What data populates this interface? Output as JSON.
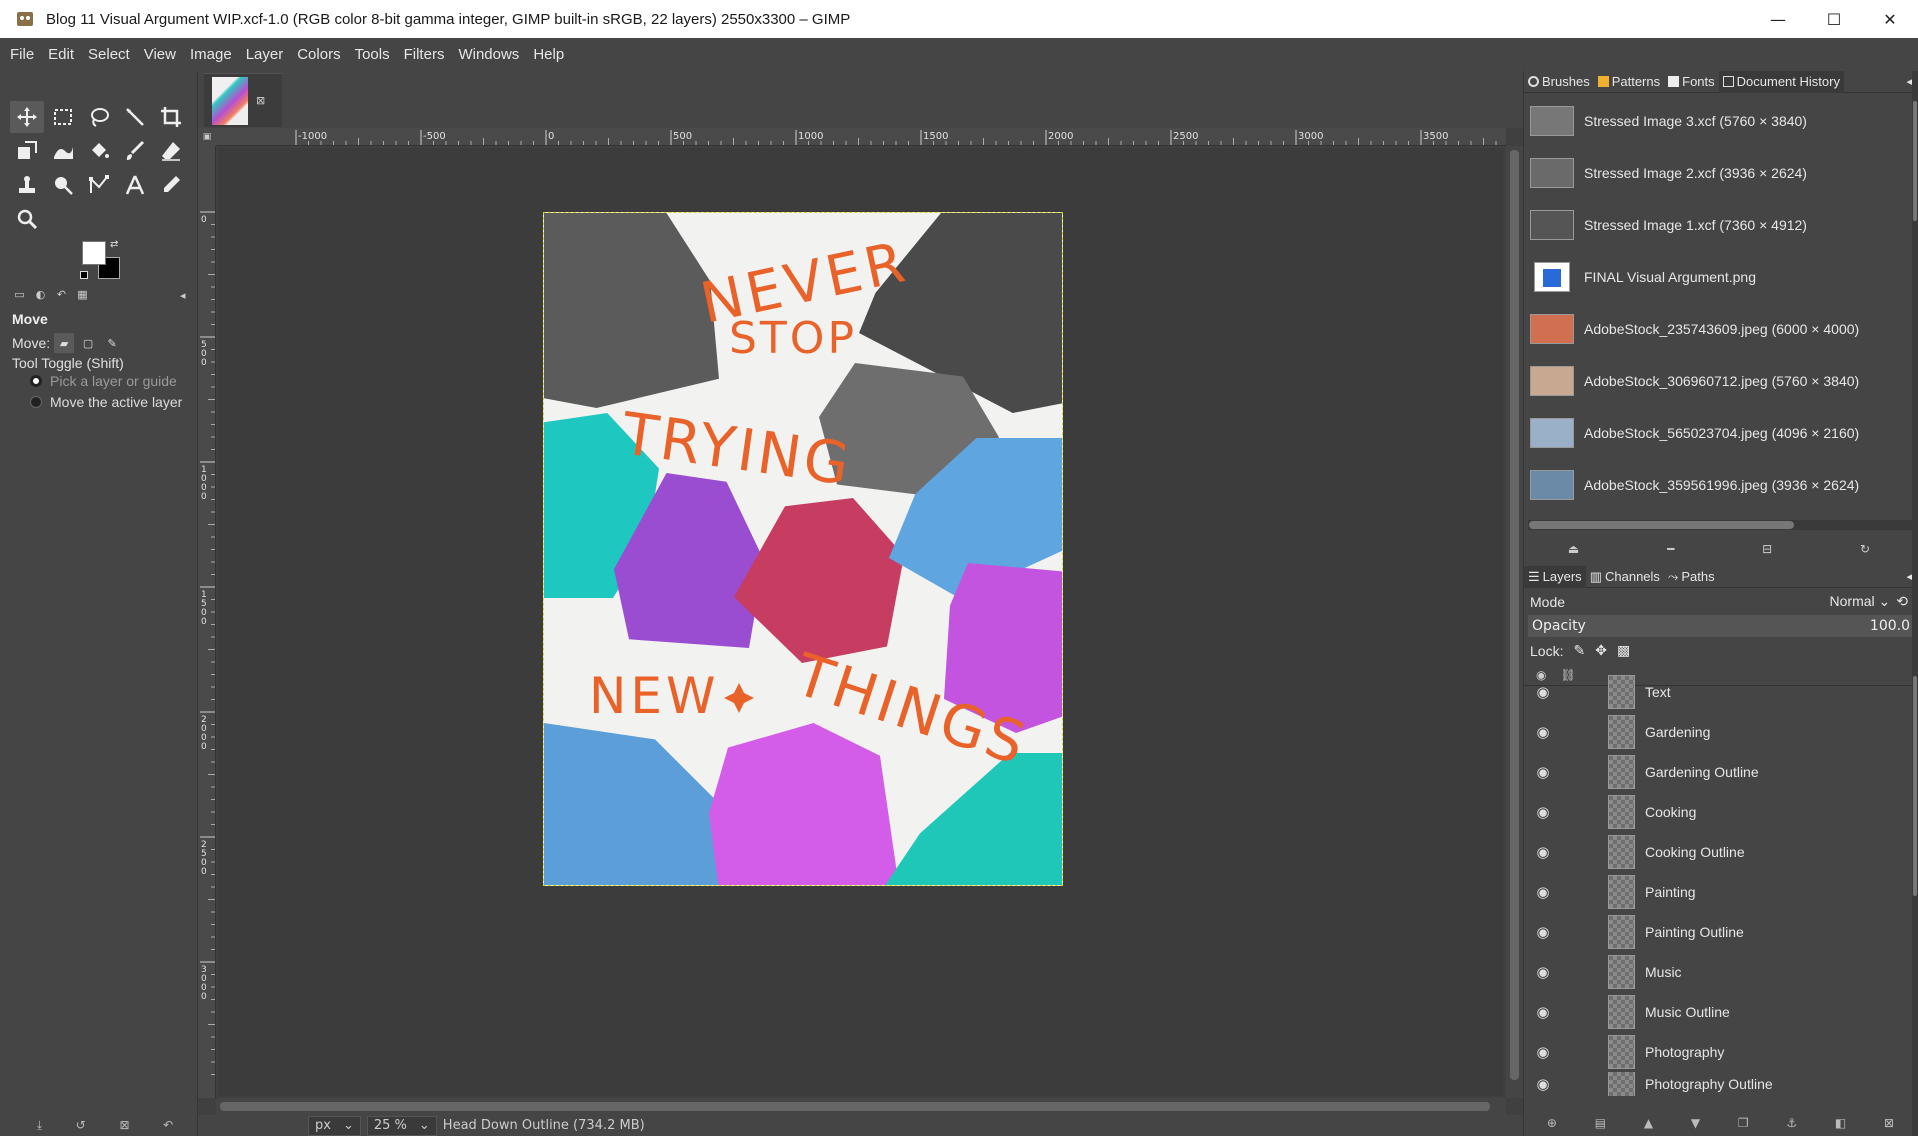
{
  "window": {
    "title": "Blog 11 Visual Argument WIP.xcf-1.0 (RGB color 8-bit gamma integer, GIMP built-in sRGB, 22 layers) 2550x3300 – GIMP",
    "minimize": "—",
    "maximize": "☐",
    "close": "✕"
  },
  "menu": [
    "File",
    "Edit",
    "Select",
    "View",
    "Image",
    "Layer",
    "Colors",
    "Tools",
    "Filters",
    "Windows",
    "Help"
  ],
  "tool_options": {
    "title": "Move",
    "move_label": "Move:",
    "tool_toggle": "Tool Toggle  (Shift)",
    "option1": "Pick a layer or guide",
    "option2": "Move the active layer"
  },
  "ruler": {
    "h_ticks": [
      "-1000",
      "-500",
      "0",
      "500",
      "1000",
      "1500",
      "2000",
      "2500",
      "3000",
      "3500"
    ],
    "v_ticks": [
      "0",
      "500",
      "1000",
      "1500",
      "2000",
      "2500",
      "3000"
    ]
  },
  "poster": {
    "line1": "NEVER",
    "line2": "STOP",
    "line3": "TRYING",
    "line4": "NEW",
    "line5": "THINGS",
    "accent": "#e8622a"
  },
  "status": {
    "unit": "px",
    "zoom": "25 %",
    "message": "Head Down Outline (734.2 MB)"
  },
  "docs_panel": {
    "tabs": [
      "Brushes",
      "Patterns",
      "Fonts",
      "Document History"
    ],
    "items": [
      "Stressed Image 3.xcf (5760 × 3840)",
      "Stressed Image 2.xcf (3936 × 2624)",
      "Stressed Image 1.xcf (7360 × 4912)",
      "FINAL Visual Argument.png",
      "AdobeStock_235743609.jpeg (6000 × 4000)",
      "AdobeStock_306960712.jpeg (5760 × 3840)",
      "AdobeStock_565023704.jpeg (4096 × 2160)",
      "AdobeStock_359561996.jpeg (3936 × 2624)"
    ]
  },
  "layers_panel": {
    "tabs": [
      "Layers",
      "Channels",
      "Paths"
    ],
    "mode_label": "Mode",
    "mode_value": "Normal",
    "opacity_label": "Opacity",
    "opacity_value": "100.0",
    "lock_label": "Lock:",
    "layers": [
      "Text",
      "Gardening",
      "Gardening Outline",
      "Cooking",
      "Cooking Outline",
      "Painting",
      "Painting Outline",
      "Music",
      "Music Outline",
      "Photography",
      "Photography Outline"
    ]
  }
}
